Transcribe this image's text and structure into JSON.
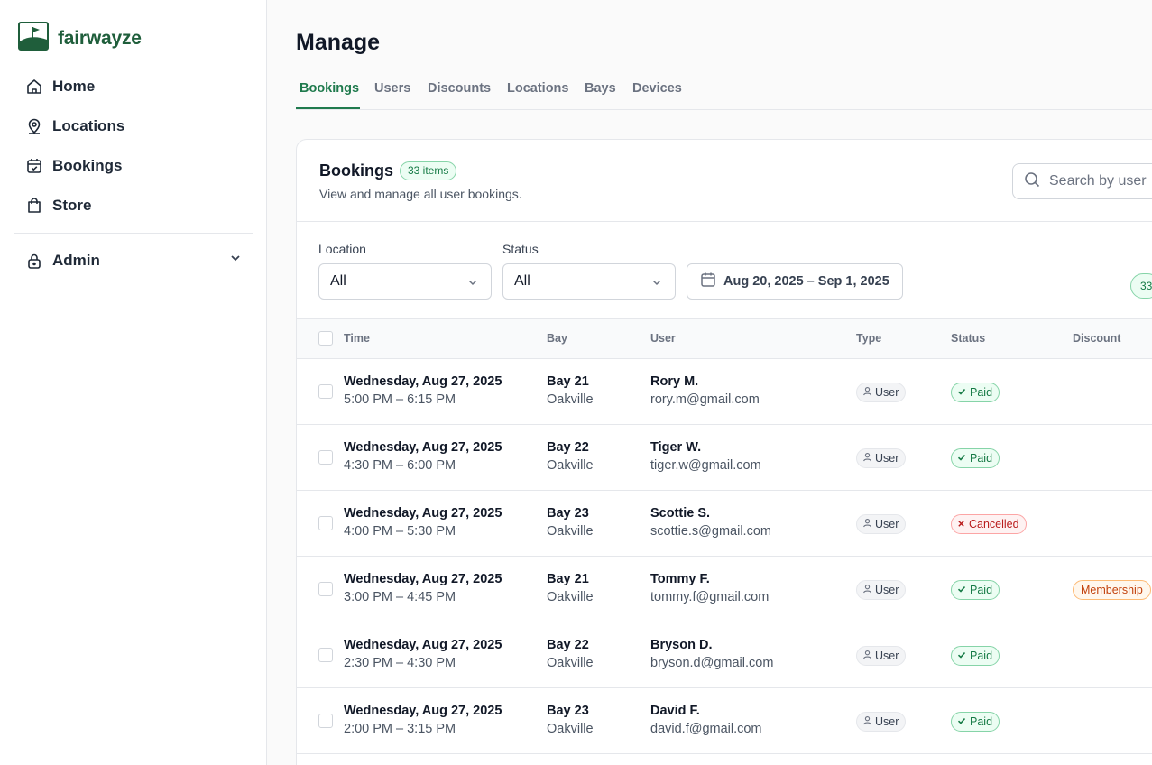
{
  "app": {
    "brand": "fairwayze",
    "colors": {
      "brand": "#1f5e3b",
      "accent": "#1f7a4d",
      "paid": "#157a45",
      "cancelled": "#b91c1c",
      "membership": "#c2410c"
    }
  },
  "sidebar": {
    "items": [
      {
        "label": "Home",
        "icon": "home-icon"
      },
      {
        "label": "Locations",
        "icon": "map-pin-icon"
      },
      {
        "label": "Bookings",
        "icon": "calendar-check-icon"
      },
      {
        "label": "Store",
        "icon": "shopping-bag-icon"
      }
    ],
    "admin": {
      "label": "Admin",
      "icon": "lock-icon"
    }
  },
  "main": {
    "title": "Manage",
    "tabs": [
      "Bookings",
      "Users",
      "Discounts",
      "Locations",
      "Bays",
      "Devices"
    ],
    "active_tab": "Bookings"
  },
  "card": {
    "title": "Bookings",
    "count_badge": "33 items",
    "subtitle": "View and manage all user bookings.",
    "search_placeholder": "Search by user",
    "filters": {
      "location_label": "Location",
      "location_value": "All",
      "status_label": "Status",
      "status_value": "All",
      "date_range": "Aug 20, 2025 – Sep 1, 2025",
      "count_pill": "33"
    },
    "columns": [
      "Time",
      "Bay",
      "User",
      "Type",
      "Status",
      "Discount"
    ],
    "rows": [
      {
        "date": "Wednesday, Aug 27, 2025",
        "time": "5:00 PM – 6:15 PM",
        "bay": "Bay 21",
        "location": "Oakville",
        "user": "Rory M.",
        "email": "rory.m@gmail.com",
        "type": "User",
        "status": "Paid",
        "discount": ""
      },
      {
        "date": "Wednesday, Aug 27, 2025",
        "time": "4:30 PM – 6:00 PM",
        "bay": "Bay 22",
        "location": "Oakville",
        "user": "Tiger W.",
        "email": "tiger.w@gmail.com",
        "type": "User",
        "status": "Paid",
        "discount": ""
      },
      {
        "date": "Wednesday, Aug 27, 2025",
        "time": "4:00 PM – 5:30 PM",
        "bay": "Bay 23",
        "location": "Oakville",
        "user": "Scottie S.",
        "email": "scottie.s@gmail.com",
        "type": "User",
        "status": "Cancelled",
        "discount": ""
      },
      {
        "date": "Wednesday, Aug 27, 2025",
        "time": "3:00 PM – 4:45 PM",
        "bay": "Bay 21",
        "location": "Oakville",
        "user": "Tommy F.",
        "email": "tommy.f@gmail.com",
        "type": "User",
        "status": "Paid",
        "discount": "Membership"
      },
      {
        "date": "Wednesday, Aug 27, 2025",
        "time": "2:30 PM – 4:30 PM",
        "bay": "Bay 22",
        "location": "Oakville",
        "user": "Bryson D.",
        "email": "bryson.d@gmail.com",
        "type": "User",
        "status": "Paid",
        "discount": ""
      },
      {
        "date": "Wednesday, Aug 27, 2025",
        "time": "2:00 PM – 3:15 PM",
        "bay": "Bay 23",
        "location": "Oakville",
        "user": "David F.",
        "email": "david.f@gmail.com",
        "type": "User",
        "status": "Paid",
        "discount": ""
      }
    ]
  }
}
